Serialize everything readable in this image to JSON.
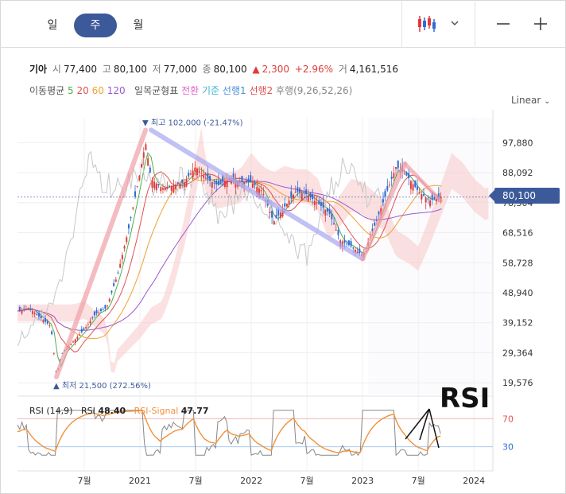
{
  "tabs": [
    {
      "label": "일",
      "active": false
    },
    {
      "label": "주",
      "active": true
    },
    {
      "label": "월",
      "active": false
    }
  ],
  "controls": {
    "chart_type_icon": "candlestick-icon",
    "dropdown_icon": "chevron-down-icon",
    "zoom_out_icon": "minus-icon",
    "zoom_in_icon": "plus-icon"
  },
  "quote": {
    "name": "기아",
    "open_label": "시",
    "open": "77,400",
    "high_label": "고",
    "high": "80,100",
    "low_label": "저",
    "low": "77,000",
    "close_label": "종",
    "close": "80,100",
    "change": "2,300",
    "change_pct": "+2.96%",
    "volume_label": "거",
    "volume": "4,161,516"
  },
  "indicators": {
    "ma_label": "이동평균",
    "ma_periods": [
      "5",
      "20",
      "60",
      "120"
    ],
    "ichimoku_label": "일목균형표",
    "ichimoku_lines": [
      "전환",
      "기준",
      "선행1",
      "선행2",
      "후행"
    ],
    "ichimoku_params": "(9,26,52,26)"
  },
  "scale_mode": "Linear",
  "annotations": {
    "high": "최고 102,000 (-21.47%)",
    "low": "최저 21,500 (272.56%)",
    "handwritten": "RSI"
  },
  "price_badge": "80,100",
  "rsi": {
    "label": "RSI (14,9)",
    "rsi_name": "RSI",
    "rsi_value": "48.40",
    "signal_name": "RSI-Signal",
    "signal_value": "47.77",
    "levels": [
      "70",
      "30"
    ]
  },
  "colors": {
    "accent": "#3c5a9a",
    "up": "#e03b3b",
    "down": "#2e6bd6",
    "ma5": "#4caf50",
    "ma20": "#e05050",
    "ma60": "#f0a030",
    "ma120": "#9b59d0",
    "rsi": "#888888",
    "rsi_signal": "#f0913a"
  },
  "chart_data": {
    "type": "line",
    "y_ticks": [
      "97,880",
      "88,092",
      "78,304",
      "68,516",
      "58,728",
      "48,940",
      "39,152",
      "29,364",
      "19,576"
    ],
    "y_ticks_num": [
      97880,
      88092,
      78304,
      68516,
      58728,
      48940,
      39152,
      29364,
      19576
    ],
    "x_ticks": [
      "7월",
      "2021",
      "7월",
      "2022",
      "7월",
      "2023",
      "7월",
      "2024"
    ],
    "x_ticks_num": [
      2020.5,
      2021.0,
      2021.5,
      2022.0,
      2022.5,
      2023.0,
      2023.5,
      2024.0
    ],
    "xlim": [
      2019.9,
      2024.17
    ],
    "ylim": [
      16000,
      106000
    ],
    "grid": true,
    "series": [
      {
        "name": "종가",
        "x": [
          2019.9,
          2020.0,
          2020.1,
          2020.2,
          2020.25,
          2020.3,
          2020.4,
          2020.5,
          2020.6,
          2020.7,
          2020.8,
          2020.9,
          2021.0,
          2021.05,
          2021.1,
          2021.2,
          2021.3,
          2021.4,
          2021.5,
          2021.6,
          2021.7,
          2021.8,
          2021.9,
          2022.0,
          2022.1,
          2022.2,
          2022.3,
          2022.4,
          2022.5,
          2022.6,
          2022.7,
          2022.8,
          2022.9,
          2023.0,
          2023.1,
          2023.2,
          2023.3,
          2023.4,
          2023.5,
          2023.6,
          2023.7
        ],
        "values": [
          43000,
          44000,
          41000,
          38000,
          22000,
          29000,
          33000,
          37000,
          42000,
          44000,
          55000,
          70000,
          88000,
          98000,
          86000,
          83000,
          84000,
          85000,
          90000,
          86000,
          84000,
          86000,
          85000,
          85000,
          82000,
          72000,
          77000,
          82000,
          81000,
          78000,
          75000,
          66000,
          64000,
          61000,
          70000,
          80000,
          90000,
          87000,
          82000,
          79000,
          80100
        ]
      }
    ]
  }
}
